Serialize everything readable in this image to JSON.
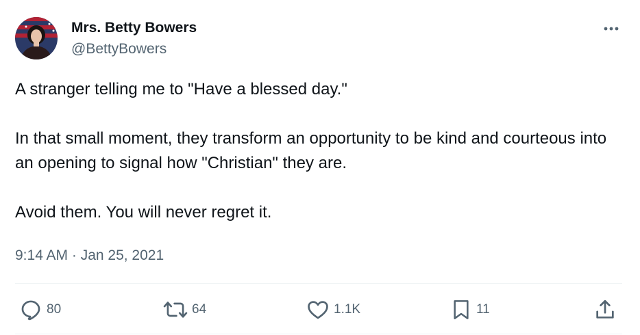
{
  "author": {
    "display_name": "Mrs. Betty Bowers",
    "handle": "@BettyBowers",
    "avatar_icon": "user-avatar"
  },
  "tweet": {
    "paragraphs": [
      "A stranger telling me to \"Have a blessed day.\"",
      "In that small moment, they transform an opportunity to be kind and courteous into an opening to signal how \"Christian\" they are.",
      "Avoid them. You will never regret it."
    ],
    "timestamp": "9:14 AM · Jan 25, 2021"
  },
  "actions": {
    "replies": "80",
    "retweets": "64",
    "likes": "1.1K",
    "bookmarks": "11"
  },
  "icons": {
    "more": "more-horizontal-icon",
    "reply": "reply-icon",
    "retweet": "retweet-icon",
    "like": "heart-icon",
    "bookmark": "bookmark-icon",
    "share": "share-icon"
  },
  "colors": {
    "text_primary": "#0f1419",
    "text_secondary": "#536471",
    "divider": "#eff3f4"
  }
}
